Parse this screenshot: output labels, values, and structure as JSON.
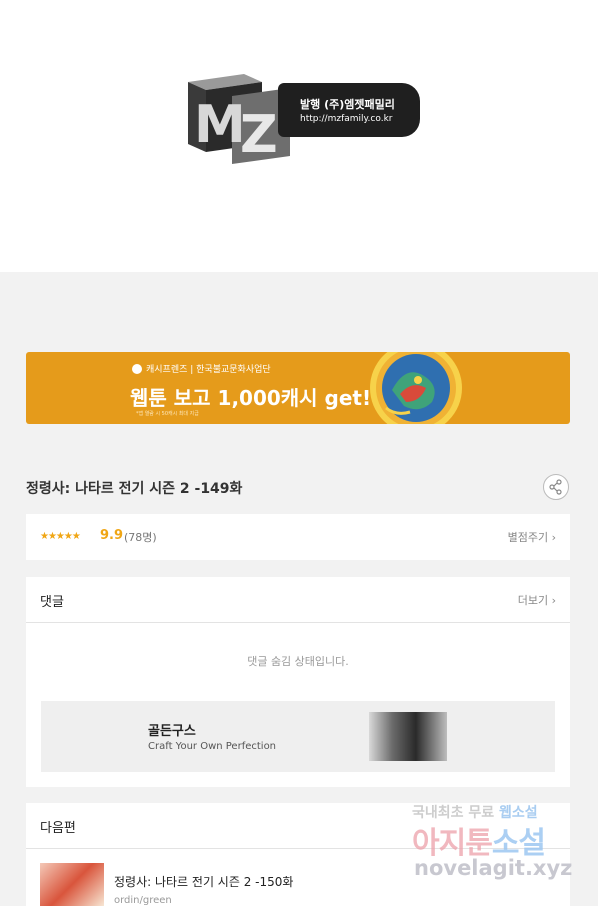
{
  "publisher": {
    "title": "발행 (주)엠젯패밀리",
    "url": "http://mzfamily.co.kr",
    "logo_mark": "MZ"
  },
  "banner": {
    "brand": "캐시프렌즈 | 한국불교문화사업단",
    "headline": "웹툰 보고 1,000캐시 get!",
    "note": "*앱 열람 시 50캐시 최대 지급"
  },
  "episode": {
    "title": "정령사: 나타르 전기 시즌 2 -149화",
    "share_icon": "share-icon"
  },
  "rating": {
    "stars": "★★★★★",
    "score": "9.9",
    "count": "(78명)",
    "rate_label": "별점주기"
  },
  "comments": {
    "title": "댓글",
    "more_label": "더보기",
    "hidden_message": "댓글 숨김 상태입니다.",
    "ad": {
      "brand": "골든구스",
      "tagline": "Craft Your Own Perfection"
    }
  },
  "next": {
    "title": "다음편",
    "episode_title": "정령사: 나타르 전기 시즌 2 -150화",
    "author": "ordin/green"
  },
  "watermark": {
    "line1_a": "국내최초 무료 ",
    "line1_b": "웹소설",
    "line2_a": "아지툰",
    "line2_b": "소설",
    "line3": "novelagit.xyz"
  },
  "colors": {
    "banner_bg": "#e59b1b",
    "star": "#f0a615"
  }
}
